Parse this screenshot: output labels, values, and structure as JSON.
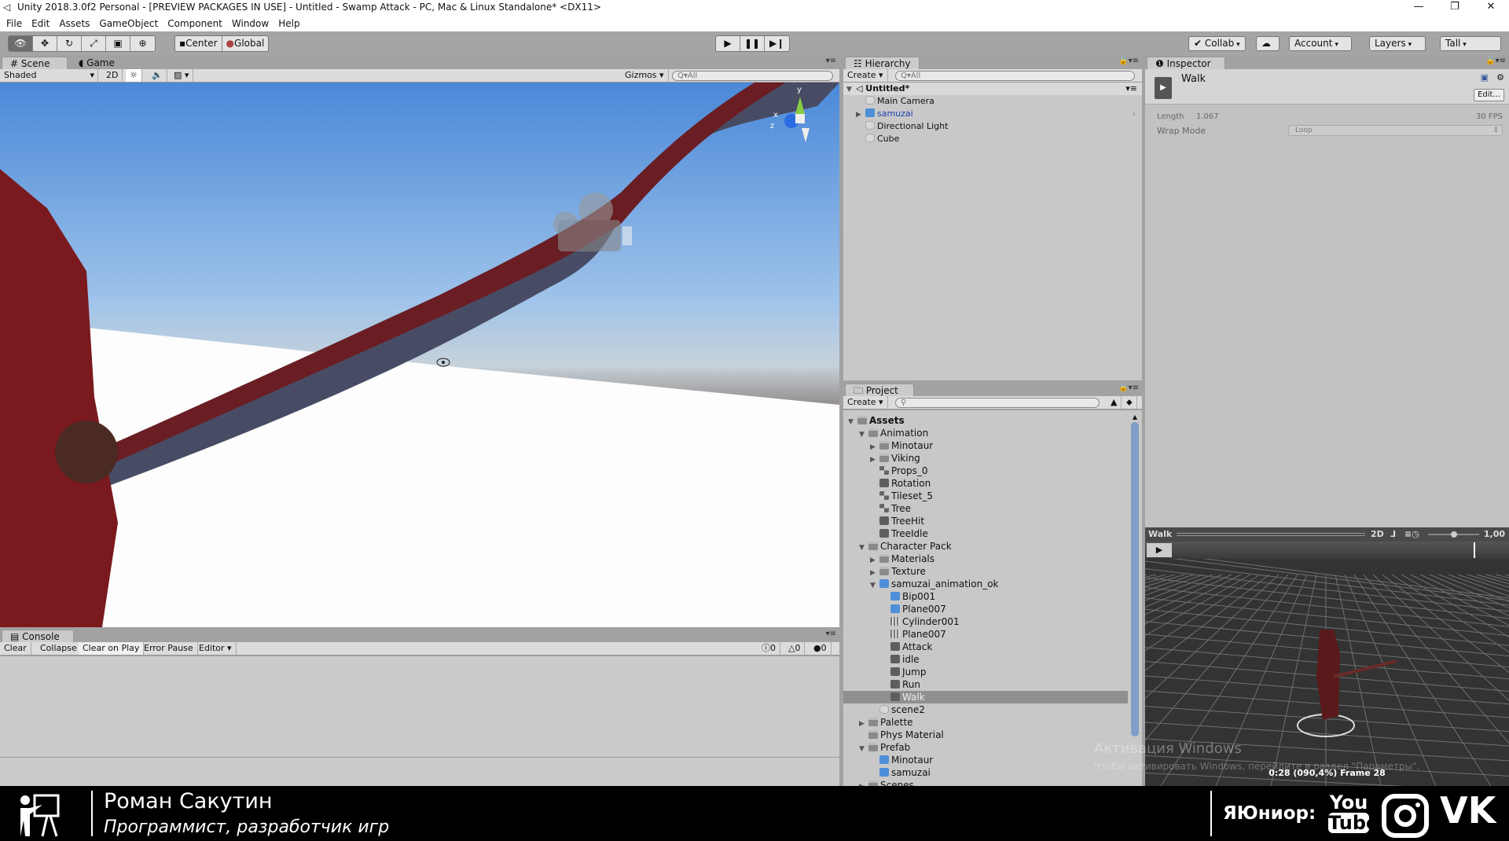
{
  "window": {
    "title": "Unity 2018.3.0f2 Personal - [PREVIEW PACKAGES IN USE] - Untitled - Swamp Attack - PC, Mac & Linux Standalone* <DX11>"
  },
  "menu": [
    "File",
    "Edit",
    "Assets",
    "GameObject",
    "Component",
    "Window",
    "Help"
  ],
  "toolbar": {
    "tools": [
      "view-tool",
      "move-tool",
      "rotate-tool",
      "scale-tool",
      "rect-tool",
      "transform-tool"
    ],
    "pivot": "Center",
    "space": "Global",
    "collab": "Collab",
    "account": "Account",
    "layers": "Layers",
    "layout": "Tall"
  },
  "scene": {
    "tabs": [
      "Scene",
      "Game"
    ],
    "shading": "Shaded",
    "mode2d": "2D",
    "gizmos": "Gizmos",
    "search_placeholder": "All",
    "axes": {
      "y": "y",
      "x": "x",
      "z": "z"
    }
  },
  "console": {
    "tab": "Console",
    "buttons": [
      "Clear",
      "Collapse",
      "Clear on Play",
      "Error Pause",
      "Editor"
    ],
    "counts": {
      "info": "0",
      "warn": "0",
      "error": "0"
    }
  },
  "hierarchy": {
    "tab": "Hierarchy",
    "create": "Create",
    "search_placeholder": "All",
    "scene": "Untitled*",
    "items": [
      {
        "label": "Main Camera"
      },
      {
        "label": "samuzai",
        "prefab": true
      },
      {
        "label": "Directional Light"
      },
      {
        "label": "Cube"
      }
    ]
  },
  "project": {
    "tab": "Project",
    "create": "Create",
    "items": [
      {
        "label": "Assets",
        "depth": 0,
        "icon": "fold",
        "open": true,
        "bold": true
      },
      {
        "label": "Animation",
        "depth": 1,
        "icon": "fold",
        "open": true
      },
      {
        "label": "Minotaur",
        "depth": 2,
        "icon": "fold",
        "closed": true
      },
      {
        "label": "Viking",
        "depth": 2,
        "icon": "fold",
        "closed": true
      },
      {
        "label": "Props_0",
        "depth": 2,
        "icon": "sprite"
      },
      {
        "label": "Rotation",
        "depth": 2,
        "icon": "anim"
      },
      {
        "label": "Tileset_5",
        "depth": 2,
        "icon": "sprite"
      },
      {
        "label": "Tree",
        "depth": 2,
        "icon": "sprite"
      },
      {
        "label": "TreeHit",
        "depth": 2,
        "icon": "anim"
      },
      {
        "label": "TreeIdle",
        "depth": 2,
        "icon": "anim"
      },
      {
        "label": "Character Pack",
        "depth": 1,
        "icon": "fold",
        "open": true
      },
      {
        "label": "Materials",
        "depth": 2,
        "icon": "fold",
        "closed": true
      },
      {
        "label": "Texture",
        "depth": 2,
        "icon": "fold",
        "closed": true
      },
      {
        "label": "samuzai_animation_ok",
        "depth": 2,
        "icon": "pre",
        "open": true
      },
      {
        "label": "Bip001",
        "depth": 3,
        "icon": "pre"
      },
      {
        "label": "Plane007",
        "depth": 3,
        "icon": "pre"
      },
      {
        "label": "Cylinder001",
        "depth": 3,
        "icon": "mesh"
      },
      {
        "label": "Plane007",
        "depth": 3,
        "icon": "mesh"
      },
      {
        "label": "Attack",
        "depth": 3,
        "icon": "anim"
      },
      {
        "label": "idle",
        "depth": 3,
        "icon": "anim"
      },
      {
        "label": "Jump",
        "depth": 3,
        "icon": "anim"
      },
      {
        "label": "Run",
        "depth": 3,
        "icon": "anim"
      },
      {
        "label": "Walk",
        "depth": 3,
        "icon": "anim",
        "selected": true
      },
      {
        "label": "scene2",
        "depth": 2,
        "icon": "go"
      },
      {
        "label": "Palette",
        "depth": 1,
        "icon": "fold",
        "closed": true
      },
      {
        "label": "Phys Material",
        "depth": 1,
        "icon": "fold"
      },
      {
        "label": "Prefab",
        "depth": 1,
        "icon": "fold",
        "open": true
      },
      {
        "label": "Minotaur",
        "depth": 2,
        "icon": "pre"
      },
      {
        "label": "samuzai",
        "depth": 2,
        "icon": "pre"
      },
      {
        "label": "Scenes",
        "depth": 1,
        "icon": "fold",
        "closed": true
      }
    ]
  },
  "inspector": {
    "tab": "Inspector",
    "name": "Walk",
    "edit": "Edit...",
    "length_label": "Length",
    "length": "1.067",
    "fps": "30 FPS",
    "wrap_label": "Wrap Mode",
    "wrap_value": "Loop"
  },
  "preview": {
    "name": "Walk",
    "mode2d": "2D",
    "speed": "1,00",
    "speed_fraction": 0.5,
    "status": "0:28 (090,4%) Frame 28",
    "progress": 0.904
  },
  "watermark": {
    "line1": "Активация Windows",
    "line2": "Чтобы активировать Windows, перейдите в раздел \"Параметры\"."
  },
  "banner": {
    "name": "Роман Сакутин",
    "role": "Программист, разработчик игр",
    "brand": "ЯЮниор:",
    "youtube_top": "You",
    "youtube_bottom": "Tube"
  }
}
